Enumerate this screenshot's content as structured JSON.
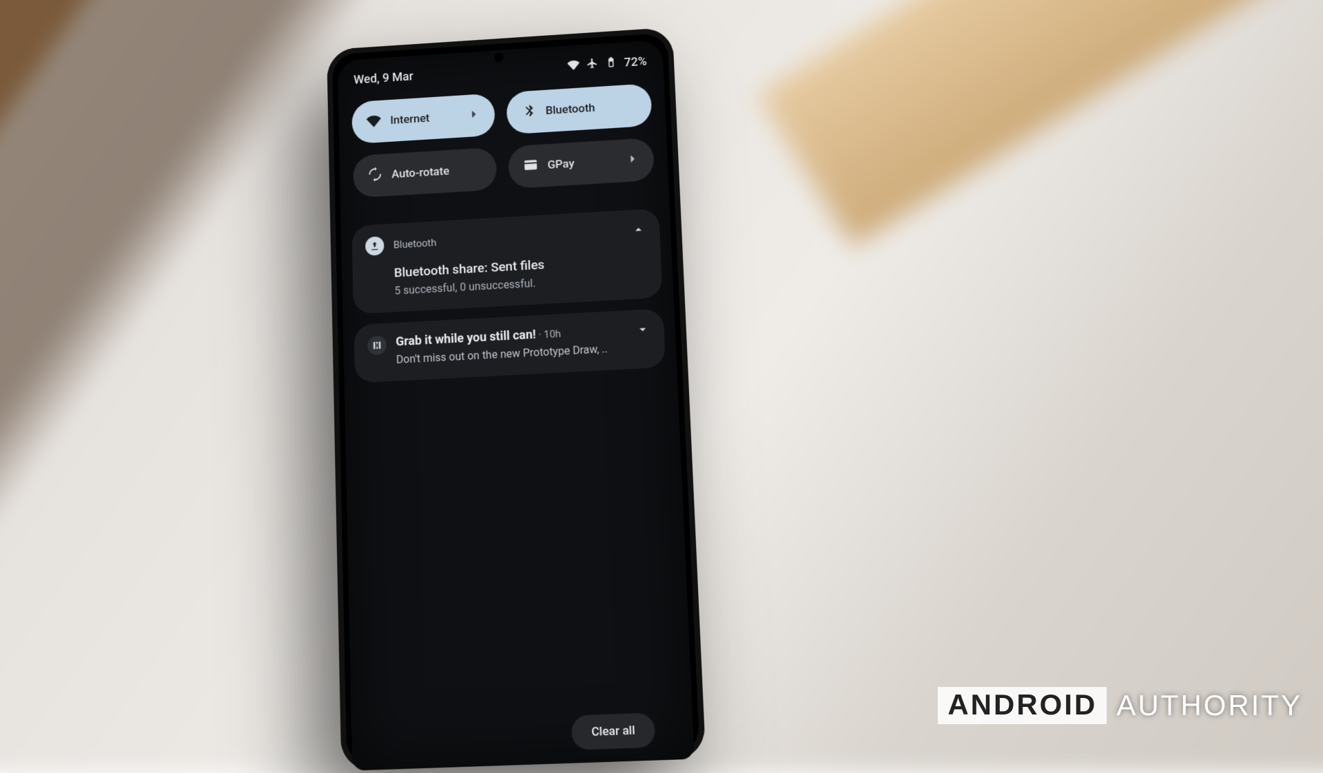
{
  "status": {
    "date": "Wed, 9 Mar",
    "battery": "72%"
  },
  "tiles": {
    "internet": "Internet",
    "bluetooth": "Bluetooth",
    "autorotate": "Auto-rotate",
    "gpay": "GPay"
  },
  "notif1": {
    "app": "Bluetooth",
    "title": "Bluetooth share: Sent files",
    "body": "5 successful, 0 unsuccessful."
  },
  "notif2": {
    "title": "Grab it while you still can!",
    "meta": " · 10h",
    "body": "Don't miss out on the new Prototype Draw, .."
  },
  "clear_all": "Clear all",
  "watermark": {
    "a": "ANDROID",
    "b": "AUTHORITY"
  }
}
